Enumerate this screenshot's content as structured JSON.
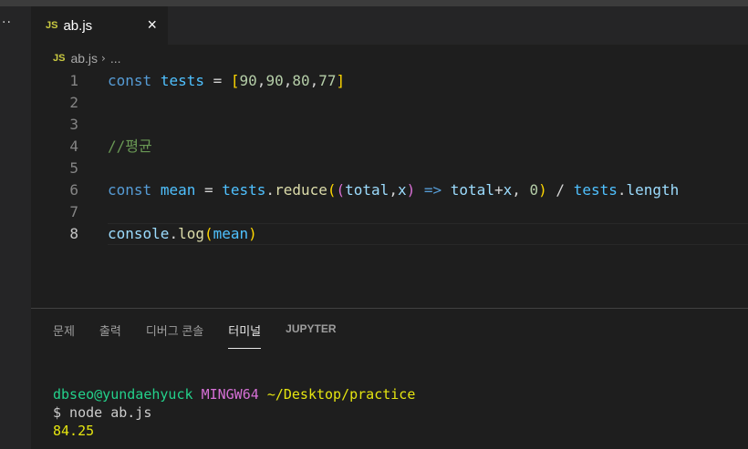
{
  "activity_bar": {
    "more": "··"
  },
  "tab": {
    "badge": "JS",
    "label": "ab.js",
    "close": "×"
  },
  "breadcrumb": {
    "badge": "JS",
    "file": "ab.js",
    "separator": "›",
    "tail": "..."
  },
  "editor": {
    "active_line": 8,
    "lines": [
      {
        "number": "1",
        "tokens": [
          {
            "cls": "kw",
            "text": "const"
          },
          {
            "cls": "op",
            "text": " "
          },
          {
            "cls": "var",
            "text": "tests"
          },
          {
            "cls": "op",
            "text": " = "
          },
          {
            "cls": "br1",
            "text": "["
          },
          {
            "cls": "num",
            "text": "90"
          },
          {
            "cls": "op",
            "text": ","
          },
          {
            "cls": "num",
            "text": "90"
          },
          {
            "cls": "op",
            "text": ","
          },
          {
            "cls": "num",
            "text": "80"
          },
          {
            "cls": "op",
            "text": ","
          },
          {
            "cls": "num",
            "text": "77"
          },
          {
            "cls": "br1",
            "text": "]"
          }
        ]
      },
      {
        "number": "2",
        "tokens": []
      },
      {
        "number": "3",
        "tokens": []
      },
      {
        "number": "4",
        "tokens": [
          {
            "cls": "cmt",
            "text": "//평균"
          }
        ]
      },
      {
        "number": "5",
        "tokens": []
      },
      {
        "number": "6",
        "tokens": [
          {
            "cls": "kw",
            "text": "const"
          },
          {
            "cls": "op",
            "text": " "
          },
          {
            "cls": "var",
            "text": "mean"
          },
          {
            "cls": "op",
            "text": " = "
          },
          {
            "cls": "var",
            "text": "tests"
          },
          {
            "cls": "op",
            "text": "."
          },
          {
            "cls": "fn",
            "text": "reduce"
          },
          {
            "cls": "br1",
            "text": "("
          },
          {
            "cls": "br2",
            "text": "("
          },
          {
            "cls": "id",
            "text": "total"
          },
          {
            "cls": "op",
            "text": ","
          },
          {
            "cls": "id",
            "text": "x"
          },
          {
            "cls": "br2",
            "text": ")"
          },
          {
            "cls": "op",
            "text": " "
          },
          {
            "cls": "kw",
            "text": "=>"
          },
          {
            "cls": "op",
            "text": " "
          },
          {
            "cls": "id",
            "text": "total"
          },
          {
            "cls": "op",
            "text": "+"
          },
          {
            "cls": "id",
            "text": "x"
          },
          {
            "cls": "op",
            "text": ", "
          },
          {
            "cls": "num",
            "text": "0"
          },
          {
            "cls": "br1",
            "text": ")"
          },
          {
            "cls": "op",
            "text": " / "
          },
          {
            "cls": "var",
            "text": "tests"
          },
          {
            "cls": "op",
            "text": "."
          },
          {
            "cls": "id",
            "text": "length"
          }
        ]
      },
      {
        "number": "7",
        "tokens": []
      },
      {
        "number": "8",
        "tokens": [
          {
            "cls": "id",
            "text": "console"
          },
          {
            "cls": "op",
            "text": "."
          },
          {
            "cls": "fn",
            "text": "log"
          },
          {
            "cls": "br1",
            "text": "("
          },
          {
            "cls": "var",
            "text": "mean"
          },
          {
            "cls": "br1",
            "text": ")"
          }
        ]
      }
    ]
  },
  "panel": {
    "tabs": [
      {
        "label": "문제",
        "active": false
      },
      {
        "label": "출력",
        "active": false
      },
      {
        "label": "디버그 콘솔",
        "active": false
      },
      {
        "label": "터미널",
        "active": true
      },
      {
        "label": "JUPYTER",
        "active": false
      }
    ],
    "terminal": {
      "user_host": "dbseo@yundaehyuck",
      "system": "MINGW64",
      "path": "~/Desktop/practice",
      "command": "$ node ab.js",
      "output": "84.25"
    }
  },
  "colors": {
    "background": "#1e1e1e",
    "keyword": "#569cd6",
    "variable": "#4fc1ff",
    "function": "#dcdcaa",
    "number": "#b5cea8",
    "comment": "#6a9955",
    "terminal_user": "#23d18b",
    "terminal_system": "#d670d6",
    "terminal_path": "#e5e510"
  }
}
